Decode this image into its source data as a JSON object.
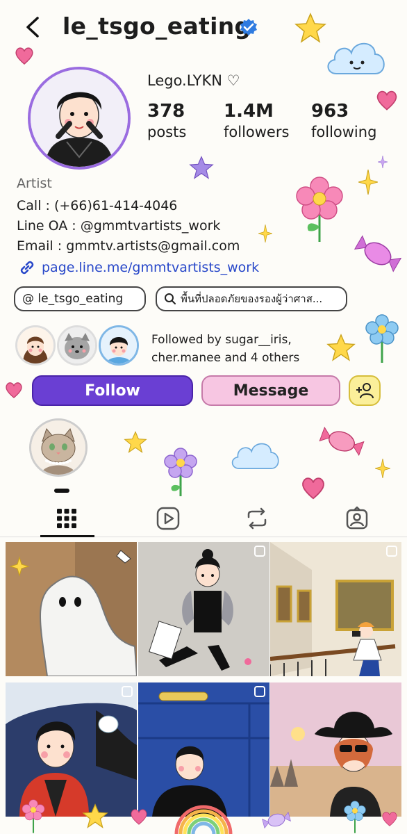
{
  "header": {
    "username": "le_tsgo_eating"
  },
  "profile": {
    "display_name": "Lego.LYKN ♡",
    "stats": [
      {
        "number": "378",
        "label": "posts"
      },
      {
        "number": "1.4M",
        "label": "followers"
      },
      {
        "number": "963",
        "label": "following"
      }
    ],
    "category": "Artist",
    "bio_lines": [
      "Call : (+66)61-414-4046",
      "Line OA : @gmmtvartists_work",
      "Email : gmmtv.artists@gmail.com"
    ],
    "link": "page.line.me/gmmtvartists_work",
    "threads_pill": "@ le_tsgo_eating",
    "search_pill": "พื้นที่ปลอดภัยของรองผู้ว่าศาส..."
  },
  "followed_by": {
    "line1": "Followed by sugar__iris,",
    "line2": "cher.manee and 4 others"
  },
  "actions": {
    "follow": "Follow",
    "message": "Message"
  },
  "tabs": [
    "grid-icon",
    "reels-icon",
    "reposts-icon",
    "tagged-icon"
  ],
  "colors": {
    "follow": "#6a3fd3",
    "message": "#f7c6e2",
    "link": "#2747c9",
    "verified": "#2f7be0"
  }
}
